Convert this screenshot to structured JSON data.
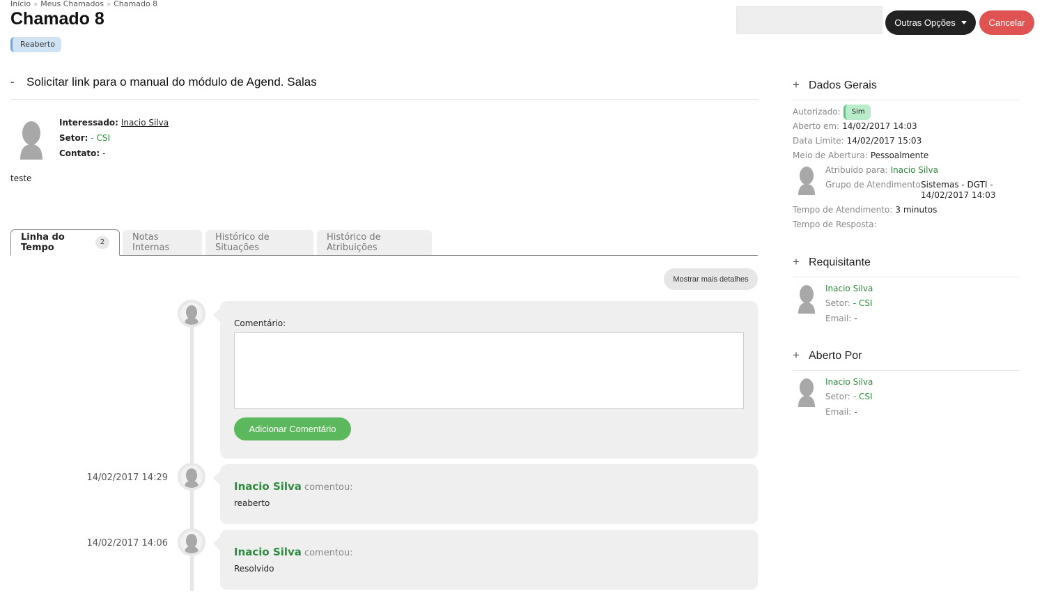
{
  "breadcrumb": [
    "Início",
    "Meus Chamados",
    "Chamado 8"
  ],
  "title": "Chamado 8",
  "status": "Reaberto",
  "actions": {
    "options_label": "Outras Opções",
    "cancel_label": "Cancelar"
  },
  "subject": {
    "toggle": "-",
    "text": "Solicitar link para o manual do módulo de Agend. Salas"
  },
  "requester": {
    "interessado_label": "Interessado:",
    "interessado": "Inacio Silva",
    "setor_label": "Setor:",
    "setor": "- CSI",
    "contato_label": "Contato:",
    "contato": "-"
  },
  "description": "teste",
  "tabs": [
    {
      "label": "Linha do Tempo",
      "count": "2"
    },
    {
      "label": "Notas Internas"
    },
    {
      "label": "Histórico de Situações"
    },
    {
      "label": "Histórico de Atribuições"
    }
  ],
  "more_details_label": "Mostrar mais detalhes",
  "comment_form": {
    "label": "Comentário:",
    "value": "",
    "submit_label": "Adicionar Comentário"
  },
  "timeline": [
    {
      "date": "14/02/2017 14:29",
      "author": "Inacio Silva",
      "verb": "comentou:",
      "text": "reaberto"
    },
    {
      "date": "14/02/2017 14:06",
      "author": "Inacio Silva",
      "verb": "comentou:",
      "text": "Resolvido"
    }
  ],
  "dados_gerais": {
    "toggle": "+",
    "title": "Dados Gerais",
    "autorizado_label": "Autorizado:",
    "autorizado": "Sim",
    "aberto_label": "Aberto em:",
    "aberto": "14/02/2017 14:03",
    "limite_label": "Data Limite:",
    "limite": "14/02/2017 15:03",
    "meio_label": "Meio de Abertura:",
    "meio": "Pessoalmente",
    "atribuido_label": "Atribuído para:",
    "atribuido": "Inacio Silva",
    "grupo_label": "Grupo de Atendimento:",
    "grupo_line1": "Sistemas - DGTI -",
    "grupo_line2": "14/02/2017 14:03",
    "tempo_atend_label": "Tempo de Atendimento:",
    "tempo_atend": "3 minutos",
    "tempo_resp_label": "Tempo de Resposta:"
  },
  "requisitante": {
    "toggle": "+",
    "title": "Requisitante",
    "name": "Inacio Silva",
    "setor_label": "Setor:",
    "setor": "- CSI",
    "email_label": "Email:",
    "email": "-"
  },
  "aberto_por": {
    "toggle": "+",
    "title": "Aberto Por",
    "name": "Inacio Silva",
    "setor_label": "Setor:",
    "setor": "- CSI",
    "email_label": "Email:",
    "email": "-"
  },
  "colors": {
    "dark": "#222222",
    "cancel": "#e05353",
    "green": "#2e8b3d",
    "button_green": "#5cb85c",
    "status_blue": "#cfe3f5"
  }
}
